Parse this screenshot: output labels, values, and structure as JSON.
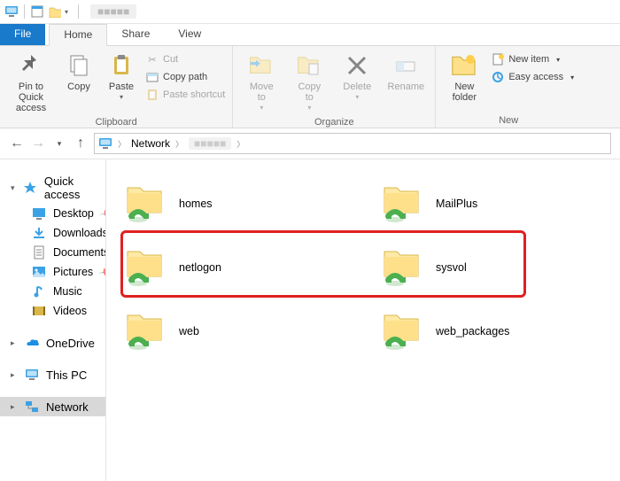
{
  "title_blur": "■■■■■",
  "tabs": {
    "file": "File",
    "home": "Home",
    "share": "Share",
    "view": "View"
  },
  "ribbon": {
    "clipboard": {
      "pin": "Pin to Quick\naccess",
      "copy": "Copy",
      "paste": "Paste",
      "cut": "Cut",
      "copypath": "Copy path",
      "pasteshortcut": "Paste shortcut",
      "label": "Clipboard"
    },
    "organize": {
      "moveto": "Move\nto",
      "copyto": "Copy\nto",
      "delete": "Delete",
      "rename": "Rename",
      "label": "Organize"
    },
    "new": {
      "newfolder": "New\nfolder",
      "newitem": "New item",
      "easyaccess": "Easy access",
      "label": "New"
    }
  },
  "breadcrumb": {
    "root": "Network",
    "child_blur": "■■■■■"
  },
  "sidebar": {
    "quickaccess": "Quick access",
    "desktop": "Desktop",
    "downloads": "Downloads",
    "documents": "Documents",
    "pictures": "Pictures",
    "music": "Music",
    "videos": "Videos",
    "onedrive": "OneDrive",
    "thispc": "This PC",
    "network": "Network"
  },
  "items": {
    "homes": "homes",
    "mailplus": "MailPlus",
    "netlogon": "netlogon",
    "sysvol": "sysvol",
    "web": "web",
    "web_packages": "web_packages"
  }
}
